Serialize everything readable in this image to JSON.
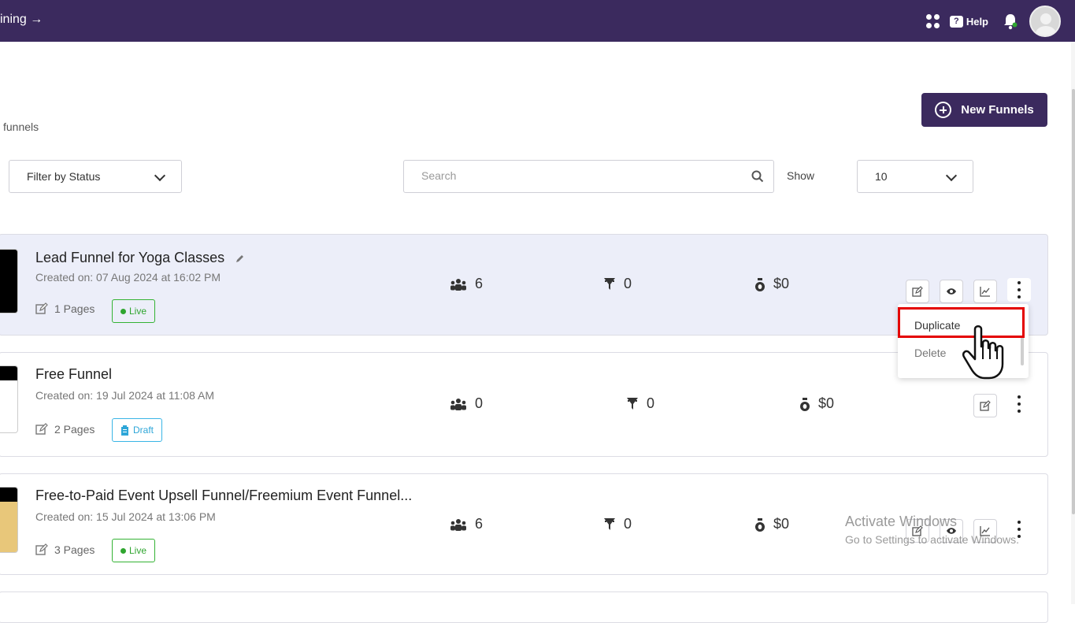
{
  "topbar": {
    "breadcrumb": "ining →",
    "help_label": "Help",
    "help_glyph": "?",
    "icons": [
      "apps-icon",
      "help-icon",
      "bell-icon",
      "avatar"
    ]
  },
  "page": {
    "subtitle": "funnels",
    "new_button": "New Funnels"
  },
  "filters": {
    "status_filter": "Filter by Status",
    "search_placeholder": "Search",
    "show_label": "Show",
    "page_size": "10"
  },
  "funnels": [
    {
      "title": "Lead Funnel for Yoga Classes",
      "created": "Created on: 07 Aug 2024 at 16:02 PM",
      "pages": "1 Pages",
      "status": "Live",
      "visitors": "6",
      "conversions": "0",
      "revenue": "$0"
    },
    {
      "title": "Free Funnel",
      "created": "Created on: 19 Jul 2024 at 11:08 AM",
      "pages": "2 Pages",
      "status": "Draft",
      "visitors": "0",
      "conversions": "0",
      "revenue": "$0"
    },
    {
      "title": "Free-to-Paid Event Upsell Funnel/Freemium Event Funnel...",
      "created": "Created on: 15 Jul 2024 at 13:06 PM",
      "pages": "3 Pages",
      "status": "Live",
      "visitors": "6",
      "conversions": "0",
      "revenue": "$0"
    }
  ],
  "context_menu": {
    "items": [
      "Duplicate",
      "Delete"
    ]
  },
  "watermark": {
    "line1": "Activate Windows",
    "line2": "Go to Settings to activate Windows."
  },
  "colors": {
    "brand": "#3b2a5e",
    "live": "#2fa52f",
    "draft": "#2ea6d8",
    "highlight": "#e40000"
  }
}
